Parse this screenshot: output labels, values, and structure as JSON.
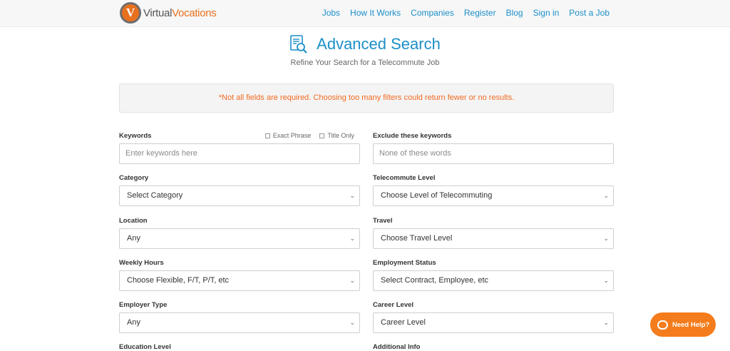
{
  "brand": {
    "mark": "V",
    "name_part1": "Virtual",
    "name_part2": "Vocations"
  },
  "nav": [
    "Jobs",
    "How It Works",
    "Companies",
    "Register",
    "Blog",
    "Sign in",
    "Post a Job"
  ],
  "page": {
    "title": "Advanced Search",
    "subtitle": "Refine Your Search for a Telecommute Job",
    "notice": "*Not all fields are required. Choosing too many filters could return fewer or no results."
  },
  "fields": {
    "keywords": {
      "label": "Keywords",
      "placeholder": "Enter keywords here",
      "exact_phrase": "Exact Phrase",
      "title_only": "Title Only"
    },
    "exclude": {
      "label": "Exclude these keywords",
      "placeholder": "None of these words"
    },
    "category": {
      "label": "Category",
      "value": "Select Category"
    },
    "telecommute": {
      "label": "Telecommute Level",
      "value": "Choose Level of Telecommuting"
    },
    "location": {
      "label": "Location",
      "value": "Any"
    },
    "travel": {
      "label": "Travel",
      "value": "Choose Travel Level"
    },
    "weekly_hours": {
      "label": "Weekly Hours",
      "value": "Choose Flexible, F/T, P/T, etc"
    },
    "employment_status": {
      "label": "Employment Status",
      "value": "Select Contract, Employee, etc"
    },
    "employer_type": {
      "label": "Employer Type",
      "value": "Any"
    },
    "career_level": {
      "label": "Career Level",
      "value": "Career Level"
    },
    "education_level": {
      "label": "Education Level"
    },
    "additional_info": {
      "label": "Additional Info"
    }
  },
  "help": {
    "label": "Need Help?"
  },
  "colors": {
    "accent": "#1b8fc9",
    "brand_orange": "#f57c1c",
    "notice_text": "#f26a21"
  }
}
